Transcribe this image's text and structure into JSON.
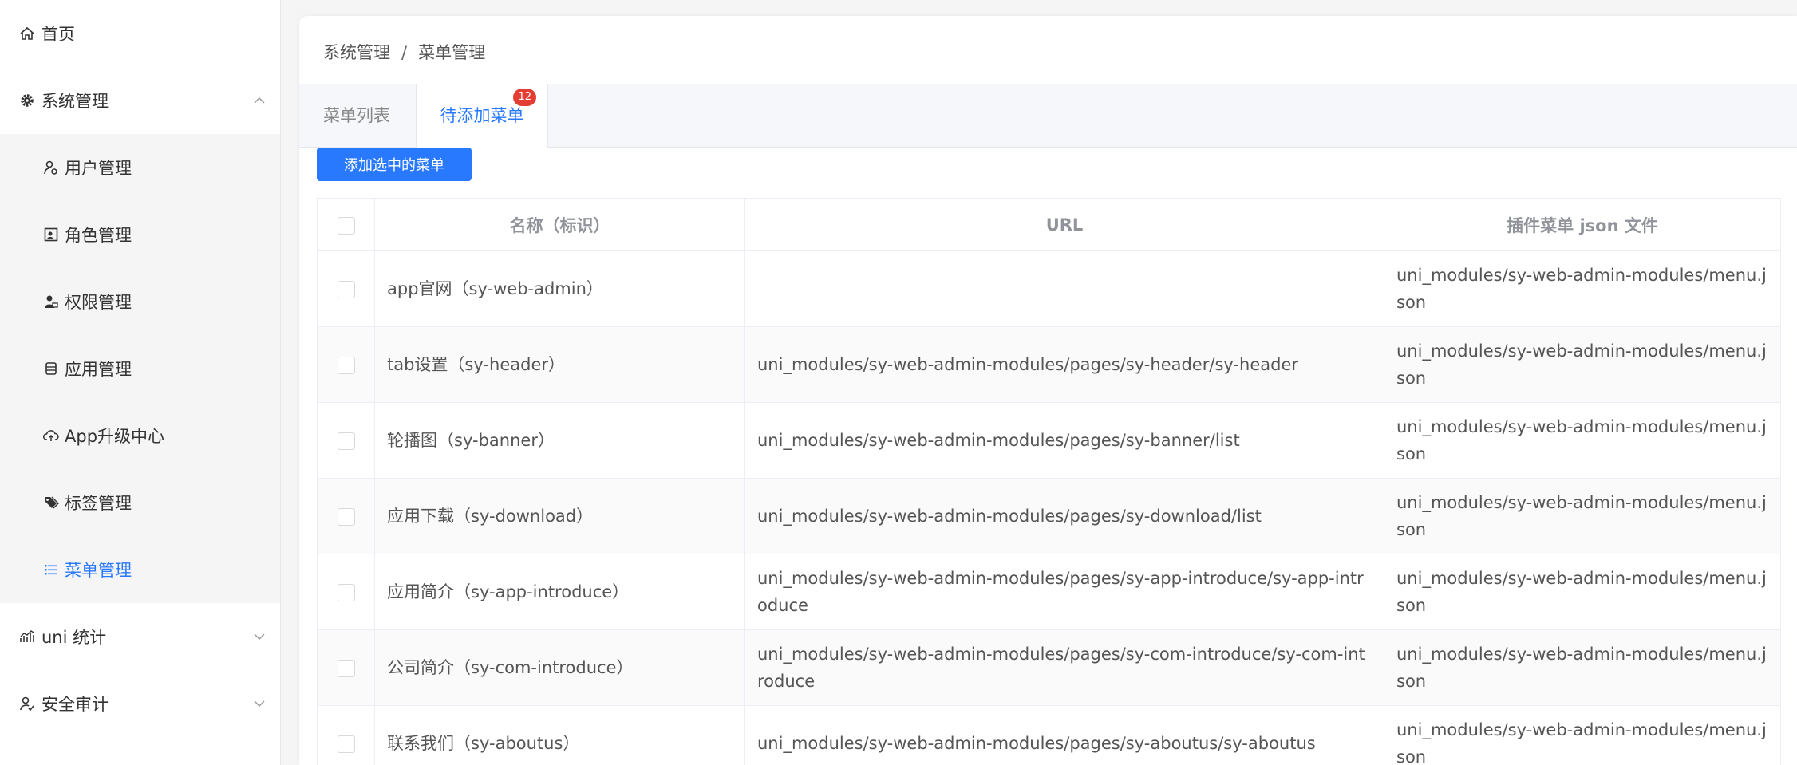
{
  "sidebar": {
    "items": [
      {
        "label": "首页",
        "icon": "home-icon"
      },
      {
        "label": "系统管理",
        "icon": "gear-icon",
        "expanded": true,
        "children": [
          {
            "label": "用户管理",
            "icon": "user-manage-icon"
          },
          {
            "label": "角色管理",
            "icon": "role-icon"
          },
          {
            "label": "权限管理",
            "icon": "permission-icon"
          },
          {
            "label": "应用管理",
            "icon": "app-icon"
          },
          {
            "label": "App升级中心",
            "icon": "cloud-upload-icon"
          },
          {
            "label": "标签管理",
            "icon": "tag-icon"
          },
          {
            "label": "菜单管理",
            "icon": "list-icon",
            "active": true
          }
        ]
      },
      {
        "label": "uni 统计",
        "icon": "stats-icon"
      },
      {
        "label": "安全审计",
        "icon": "audit-icon"
      }
    ]
  },
  "breadcrumb": {
    "parent": "系统管理",
    "separator": "/",
    "current": "菜单管理"
  },
  "tabs": [
    {
      "label": "菜单列表"
    },
    {
      "label": "待添加菜单",
      "badge": "12",
      "active": true
    }
  ],
  "actions": {
    "add_selected": "添加选中的菜单"
  },
  "table": {
    "headers": {
      "name": "名称（标识）",
      "url": "URL",
      "json": "插件菜单 json 文件"
    },
    "rows": [
      {
        "name": "app官网（sy-web-admin）",
        "url": "",
        "json": "uni_modules/sy-web-admin-modules/menu.json"
      },
      {
        "name": "tab设置（sy-header）",
        "url": "uni_modules/sy-web-admin-modules/pages/sy-header/sy-header",
        "json": "uni_modules/sy-web-admin-modules/menu.json"
      },
      {
        "name": "轮播图（sy-banner）",
        "url": "uni_modules/sy-web-admin-modules/pages/sy-banner/list",
        "json": "uni_modules/sy-web-admin-modules/menu.json"
      },
      {
        "name": "应用下载（sy-download）",
        "url": "uni_modules/sy-web-admin-modules/pages/sy-download/list",
        "json": "uni_modules/sy-web-admin-modules/menu.json"
      },
      {
        "name": "应用简介（sy-app-introduce）",
        "url": "uni_modules/sy-web-admin-modules/pages/sy-app-introduce/sy-app-introduce",
        "json": "uni_modules/sy-web-admin-modules/menu.json"
      },
      {
        "name": "公司简介（sy-com-introduce）",
        "url": "uni_modules/sy-web-admin-modules/pages/sy-com-introduce/sy-com-introduce",
        "json": "uni_modules/sy-web-admin-modules/menu.json"
      },
      {
        "name": "联系我们（sy-aboutus）",
        "url": "uni_modules/sy-web-admin-modules/pages/sy-aboutus/sy-aboutus",
        "json": "uni_modules/sy-web-admin-modules/menu.json"
      }
    ]
  },
  "colors": {
    "accent": "#2979ff",
    "badge": "#e43d33",
    "sidebar_sub_bg": "#f5f5f5"
  }
}
